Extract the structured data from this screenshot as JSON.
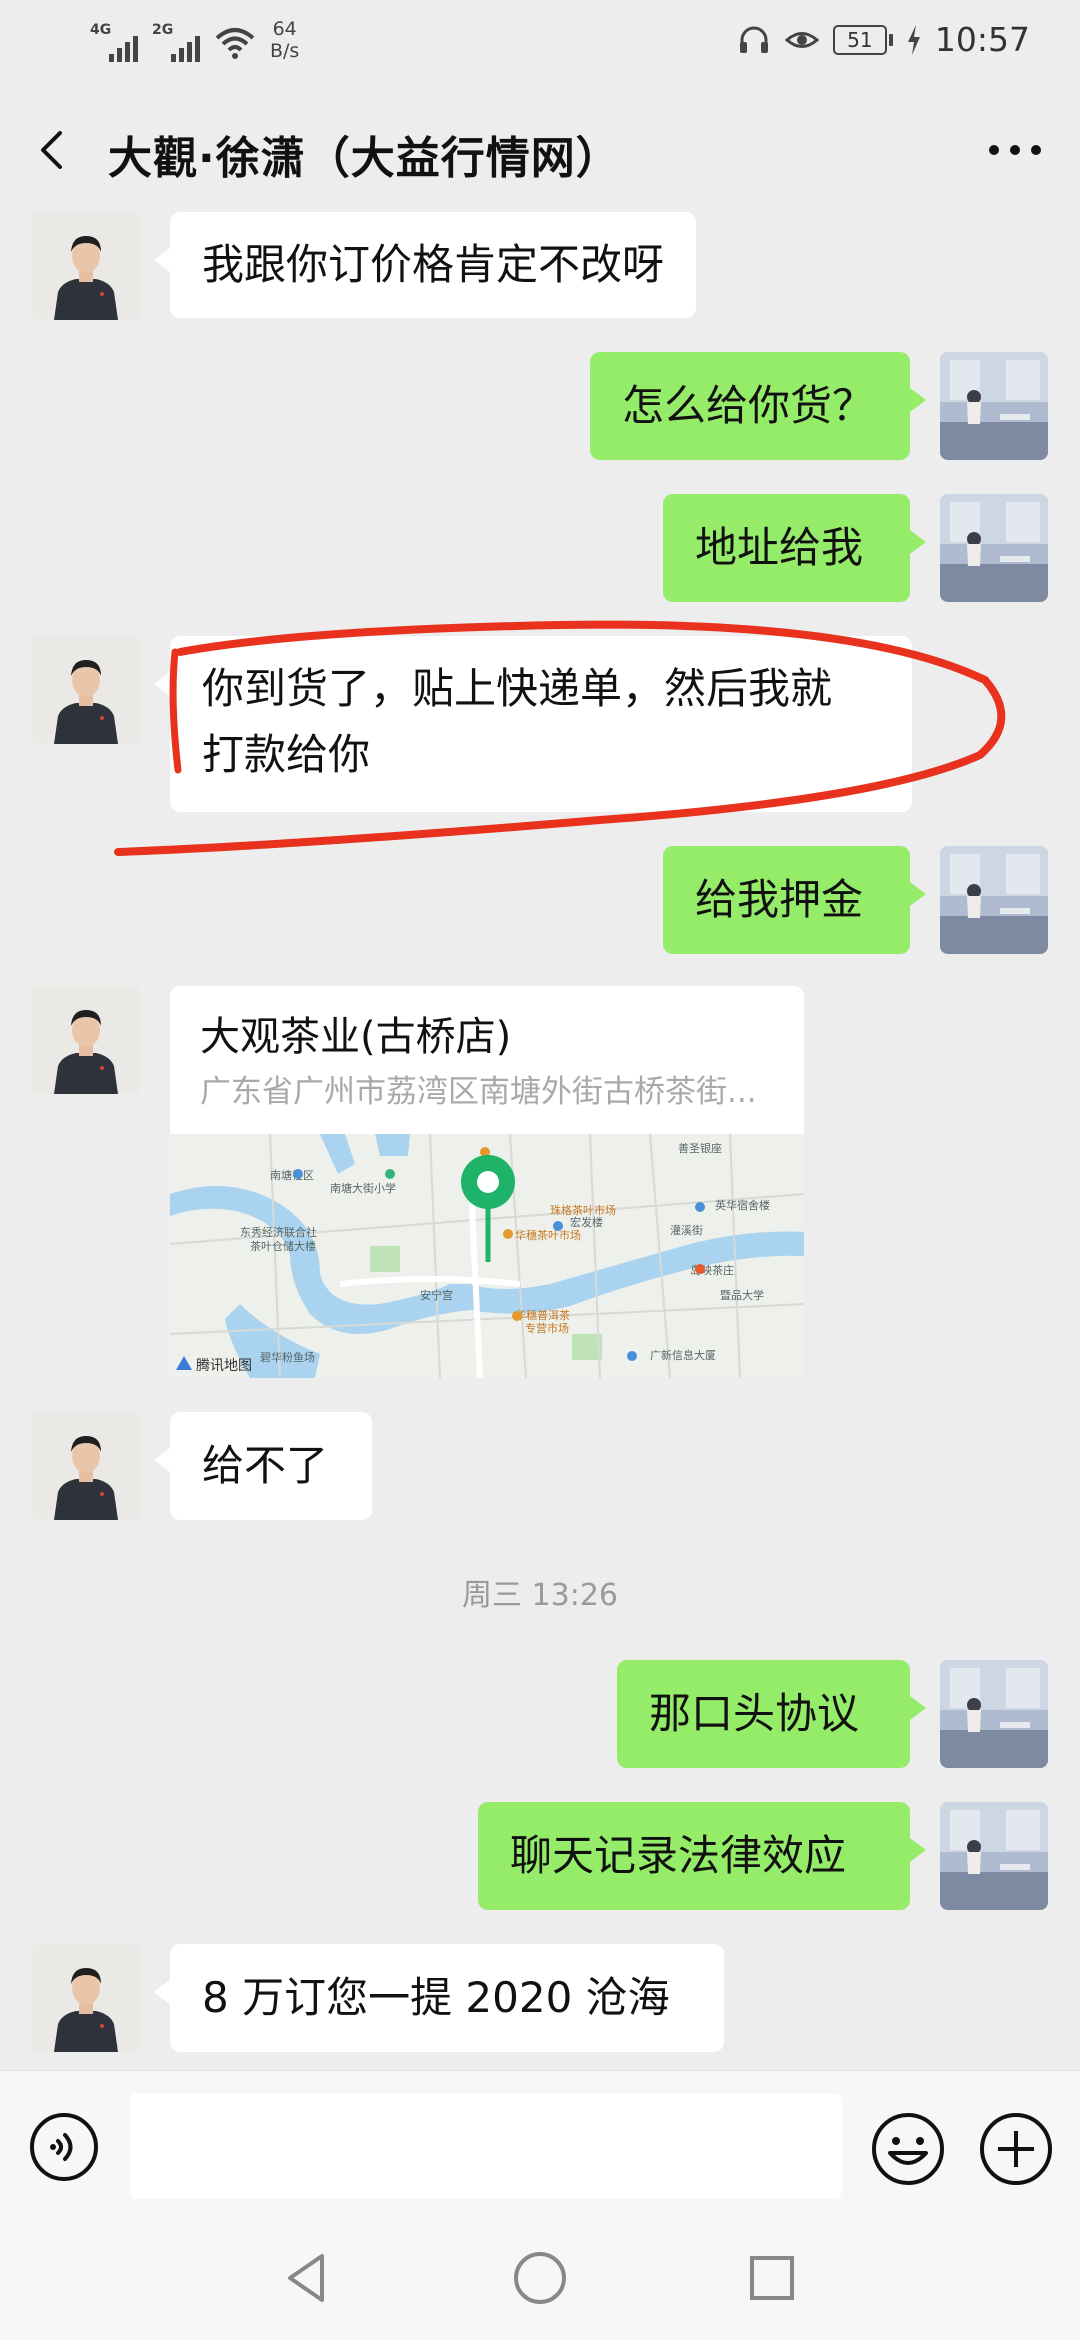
{
  "status_bar": {
    "network_1": "4G",
    "network_2": "2G",
    "speed_value": "64",
    "speed_unit": "B/s",
    "battery": "51",
    "time": "10:57",
    "icons": [
      "signal-icon",
      "wifi-icon",
      "headset-icon",
      "eye-icon",
      "battery-icon",
      "charging-icon"
    ]
  },
  "header": {
    "title": "大觀·徐潇（大益行情网）",
    "back_icon": "back-arrow-icon",
    "more_icon": "more-dots-icon"
  },
  "messages": [
    {
      "sender": "other",
      "text": "我跟你订价格肯定不改呀"
    },
    {
      "sender": "self",
      "text": "怎么给你货？"
    },
    {
      "sender": "self",
      "text": "地址给我"
    },
    {
      "sender": "other",
      "lines": [
        "你到货了，贴上快递单，然后我就",
        "打款给你"
      ]
    },
    {
      "sender": "self",
      "text": "给我押金"
    },
    {
      "sender": "other",
      "type": "location",
      "name": "大观茶业(古桥店)",
      "address": "广东省广州市荔湾区南塘外街古桥茶街...",
      "map_brand": "腾讯地图"
    },
    {
      "sender": "other",
      "text": "给不了"
    },
    {
      "sender": "self",
      "text": "那口头协议"
    },
    {
      "sender": "self",
      "text": "聊天记录法律效应"
    },
    {
      "sender": "other",
      "text": "8 万订您一提 2020 沧海"
    }
  ],
  "timestamp": "周三 13:26",
  "map_labels": [
    "南塘社区",
    "南塘大街小学",
    "东秀经济联合社",
    "茶叶仓储大楼",
    "华穗茶叶市场",
    "宏发楼",
    "英华宿舍楼",
    "善圣银座",
    "岛映茶庄",
    "珠格茶叶市场",
    "华穗普洱茶",
    "专营市场",
    "广新信息大厦",
    "碧华粉鱼场",
    "暨品大学",
    "安宁宫",
    "灌溪街"
  ],
  "input_bar": {
    "placeholder": "",
    "voice_icon": "voice-icon",
    "emoji_icon": "emoji-icon",
    "plus_icon": "plus-icon"
  },
  "nav_bar": [
    "back-triangle-icon",
    "home-circle-icon",
    "recents-square-icon"
  ],
  "colors": {
    "background": "#ededed",
    "self_bubble": "#95ec69",
    "other_bubble": "#ffffff",
    "annotation": "#e8321d",
    "map_pin": "#1fb36a"
  }
}
